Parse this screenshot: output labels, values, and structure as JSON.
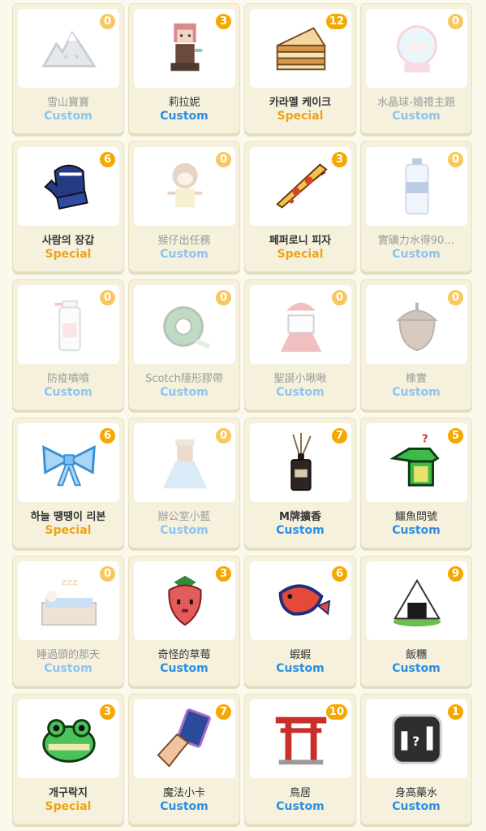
{
  "colors": {
    "badge": "#f5a800",
    "custom_tag": "#2b8fe0",
    "special_tag": "#eda318",
    "card_background": "#f6f1dd",
    "page_background": "#fbf8ec"
  },
  "items": [
    {
      "name": "雪山寶寶",
      "tag": "Custom",
      "count": "0",
      "icon": "snow-mountain-icon"
    },
    {
      "name": "莉拉妮",
      "tag": "Custom",
      "count": "3",
      "icon": "lilani-character-icon"
    },
    {
      "name": "카라멜 케이크",
      "tag": "Special",
      "count": "12",
      "icon": "caramel-cake-icon"
    },
    {
      "name": "水晶球-婚禮主題",
      "tag": "Custom",
      "count": "0",
      "icon": "crystal-ball-icon"
    },
    {
      "name": "사람의 장갑",
      "tag": "Special",
      "count": "6",
      "icon": "mitten-icon"
    },
    {
      "name": "猴仔出任務",
      "tag": "Custom",
      "count": "0",
      "icon": "monkey-icon"
    },
    {
      "name": "페퍼로니 피자",
      "tag": "Special",
      "count": "3",
      "icon": "pizza-icon"
    },
    {
      "name": "實礦力水得90…",
      "tag": "Custom",
      "count": "0",
      "icon": "water-bottle-icon"
    },
    {
      "name": "防疫噴噴",
      "tag": "Custom",
      "count": "0",
      "icon": "spray-bottle-icon"
    },
    {
      "name": "Scotch隱形膠帶",
      "tag": "Custom",
      "count": "0",
      "icon": "tape-icon"
    },
    {
      "name": "聖誕小啾啾",
      "tag": "Custom",
      "count": "0",
      "icon": "christmas-girl-icon"
    },
    {
      "name": "橡實",
      "tag": "Custom",
      "count": "0",
      "icon": "acorn-icon"
    },
    {
      "name": "하늘 땡땡이 리본",
      "tag": "Special",
      "count": "6",
      "icon": "blue-ribbon-icon"
    },
    {
      "name": "辦公室小藍",
      "tag": "Custom",
      "count": "0",
      "icon": "office-blue-icon"
    },
    {
      "name": "M牌擴香",
      "tag": "Custom",
      "count": "7",
      "icon": "reed-diffuser-icon"
    },
    {
      "name": "鱷魚問號",
      "tag": "Custom",
      "count": "5",
      "icon": "crocodile-icon"
    },
    {
      "name": "睡過頭的那天",
      "tag": "Custom",
      "count": "0",
      "icon": "sleeping-bed-icon"
    },
    {
      "name": "奇怪的草莓",
      "tag": "Custom",
      "count": "3",
      "icon": "strawberry-icon"
    },
    {
      "name": "蝦蝦",
      "tag": "Custom",
      "count": "6",
      "icon": "shrimp-icon"
    },
    {
      "name": "飯糰",
      "tag": "Custom",
      "count": "9",
      "icon": "rice-ball-icon"
    },
    {
      "name": "개구락지",
      "tag": "Special",
      "count": "3",
      "icon": "frog-icon"
    },
    {
      "name": "魔法小卡",
      "tag": "Custom",
      "count": "7",
      "icon": "magic-card-icon"
    },
    {
      "name": "鳥居",
      "tag": "Custom",
      "count": "10",
      "icon": "torii-gate-icon"
    },
    {
      "name": "身高藥水",
      "tag": "Custom",
      "count": "1",
      "icon": "height-potion-icon"
    }
  ]
}
